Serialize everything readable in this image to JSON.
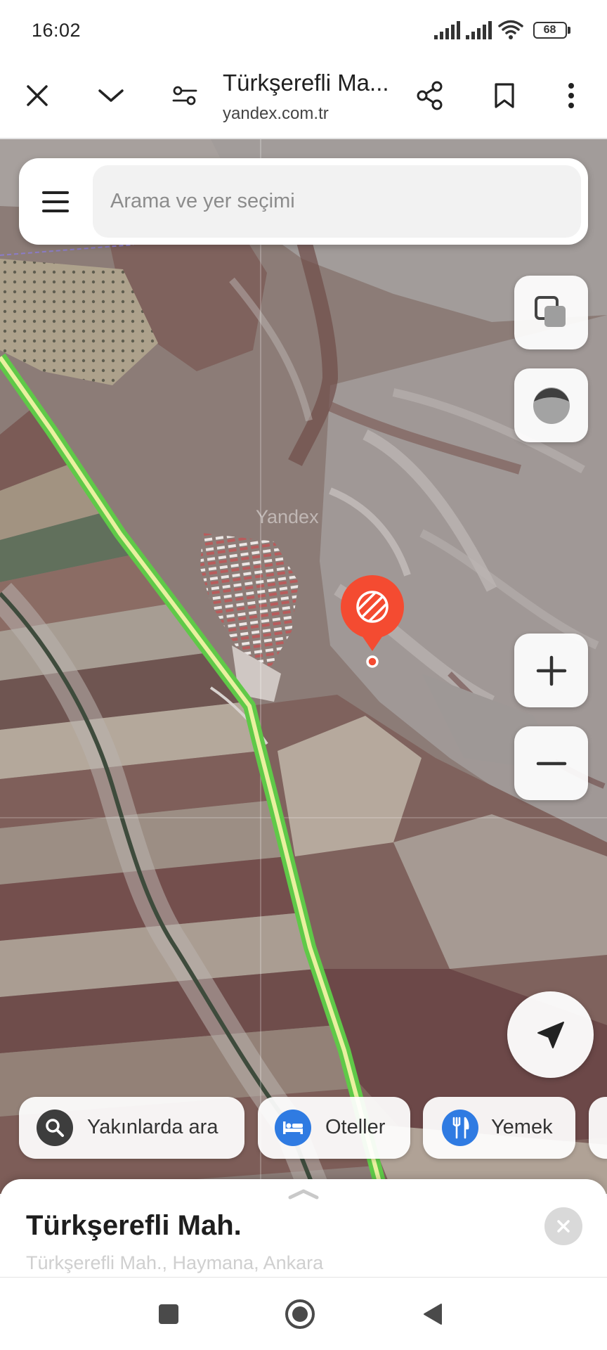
{
  "status_bar": {
    "time": "16:02",
    "battery_level": "68",
    "icons": [
      "signal-icon",
      "signal-icon",
      "wifi-icon",
      "battery-icon"
    ]
  },
  "browser_toolbar": {
    "title": "Türkşerefli Ma...",
    "url": "yandex.com.tr",
    "icons": [
      "close-icon",
      "chevron-down-icon",
      "page-info-icon",
      "share-icon",
      "bookmark-icon",
      "more-vert-icon"
    ]
  },
  "search": {
    "placeholder": "Arama ve yer seçimi",
    "menu_icon": "menu-icon"
  },
  "map": {
    "view": "satellite",
    "watermark": "Yandex",
    "controls": [
      "layers-icon",
      "traffic-icon",
      "zoom-in-icon",
      "zoom-out-icon",
      "my-location-icon"
    ],
    "marker_icon": "hatched-area-icon",
    "marker_color": "#f44b31",
    "road_color": "#5fc948"
  },
  "categories": [
    {
      "label": "Yakınlarda ara",
      "icon": "search-icon",
      "icon_bg": "#3d3d3d"
    },
    {
      "label": "Oteller",
      "icon": "bed-icon",
      "icon_bg": "#2f7be2"
    },
    {
      "label": "Yemek",
      "icon": "fork-knife-icon",
      "icon_bg": "#2f7be2"
    }
  ],
  "place_card": {
    "title": "Türkşerefli Mah.",
    "subtitle": "Türkşerefli Mah., Haymana, Ankara",
    "icons": [
      "chevron-up-icon",
      "close-icon"
    ]
  },
  "nav_bar": {
    "icons": [
      "recent-apps-icon",
      "home-icon",
      "back-icon"
    ]
  }
}
